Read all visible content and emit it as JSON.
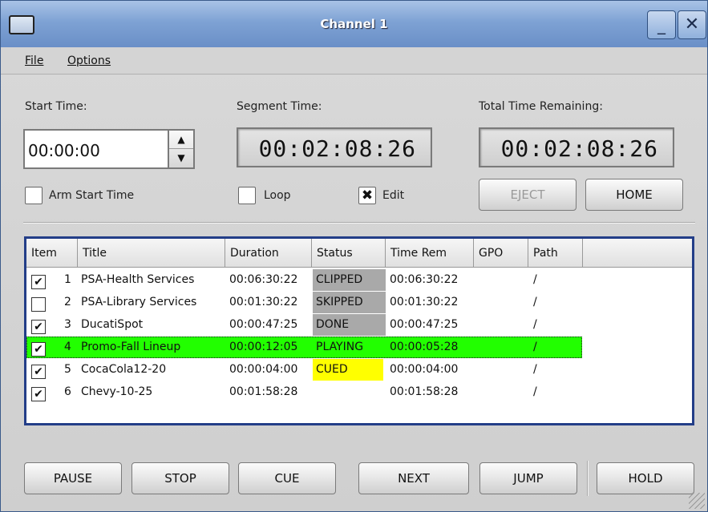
{
  "window": {
    "title": "Channel 1",
    "minimize_glyph": "_",
    "close_glyph": "✕"
  },
  "menu": {
    "file": "File",
    "options": "Options"
  },
  "start_time": {
    "label": "Start Time:",
    "value": "00:00:00",
    "up": "▲",
    "down": "▼"
  },
  "segment_time": {
    "label": "Segment Time:",
    "value": "00:02:08:26"
  },
  "total_remaining": {
    "label": "Total Time Remaining:",
    "value": "00:02:08:26"
  },
  "options": {
    "arm_start_time": {
      "label": "Arm Start Time",
      "checked": false,
      "mark": ""
    },
    "loop": {
      "label": "Loop",
      "checked": false,
      "mark": ""
    },
    "edit": {
      "label": "Edit",
      "checked": true,
      "mark": "✖"
    }
  },
  "top_buttons": {
    "eject": "EJECT",
    "home": "HOME"
  },
  "table": {
    "headers": [
      "Item",
      "Title",
      "Duration",
      "Status",
      "Time Rem",
      "GPO",
      "Path"
    ],
    "rows": [
      {
        "check": "✔",
        "num": "1",
        "title": "PSA-Health Services",
        "duration": "00:06:30:22",
        "status": "CLIPPED",
        "time_rem": "00:06:30:22",
        "gpo": "",
        "path": "/"
      },
      {
        "check": "",
        "num": "2",
        "title": "PSA-Library Services",
        "duration": "00:01:30:22",
        "status": "SKIPPED",
        "time_rem": "00:01:30:22",
        "gpo": "",
        "path": "/"
      },
      {
        "check": "✔",
        "num": "3",
        "title": "DucatiSpot",
        "duration": "00:00:47:25",
        "status": "DONE",
        "time_rem": "00:00:47:25",
        "gpo": "",
        "path": "/"
      },
      {
        "check": "✔",
        "num": "4",
        "title": "Promo-Fall Lineup",
        "duration": "00:00:12:05",
        "status": "PLAYING",
        "time_rem": "00:00:05:28",
        "gpo": "",
        "path": "/"
      },
      {
        "check": "✔",
        "num": "5",
        "title": "CocaCola12-20",
        "duration": "00:00:04:00",
        "status": "CUED",
        "time_rem": "00:00:04:00",
        "gpo": "",
        "path": "/"
      },
      {
        "check": "✔",
        "num": "6",
        "title": "Chevy-10-25",
        "duration": "00:01:58:28",
        "status": "",
        "time_rem": "00:01:58:28",
        "gpo": "",
        "path": "/"
      }
    ]
  },
  "bottom_buttons": {
    "pause": "PAUSE",
    "stop": "STOP",
    "cue": "CUE",
    "next": "NEXT",
    "jump": "JUMP",
    "hold": "HOLD"
  },
  "colors": {
    "playing_row": "#22ff00",
    "cued_status": "#ffff00",
    "done_status": "#a9a9a9",
    "table_border": "#233e88",
    "titlebar": "#7ea2d4"
  }
}
